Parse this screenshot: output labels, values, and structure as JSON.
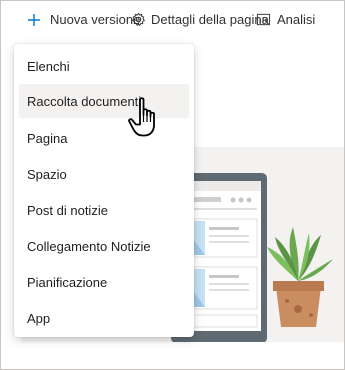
{
  "toolbar": {
    "new_label": "Nuova versione",
    "new_icon": "plus-icon",
    "details_label": "Dettagli della pagina",
    "details_icon": "gear-icon",
    "analytics_label": "Analisi",
    "analytics_icon": "chart-icon"
  },
  "menu": {
    "items": [
      {
        "label": "Elenchi"
      },
      {
        "label": "Raccolta documenti",
        "state": "hover"
      },
      {
        "label": "Pagina"
      },
      {
        "label": "Spazio"
      },
      {
        "label": "Post di notizie"
      },
      {
        "label": "Collegamento Notizie"
      },
      {
        "label": "Pianificazione"
      },
      {
        "label": "App"
      }
    ]
  },
  "cursor": {
    "icon": "hand-pointer-icon"
  },
  "illustration": {
    "icon": "laptop-with-plant-illustration"
  },
  "colors": {
    "accent": "#0078d4",
    "hover_bg": "#f3f2f1",
    "canvas_bg": "#f3f2f1",
    "plant": "#6aa84f",
    "pot": "#c98d60"
  }
}
